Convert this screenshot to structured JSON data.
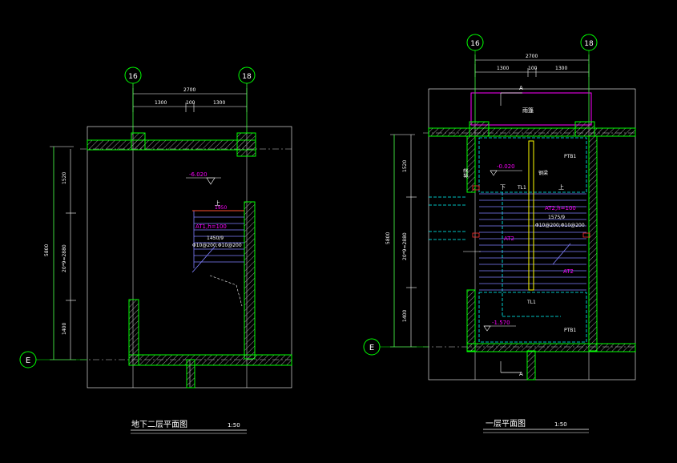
{
  "colors": {
    "background": "#000000",
    "wall": "#00ff00",
    "dimension": "#ffffff",
    "label": "#ff00ff",
    "hatch": "#808080",
    "stair": "#8080ff",
    "cyan": "#00ffff",
    "yellow": "#ffff00",
    "red": "#ff3030"
  },
  "left_plan": {
    "axis_left": "16",
    "axis_right": "18",
    "axis_bottom": "E",
    "dim_total_top": "2700",
    "dim_parts_top": [
      "1300",
      "100",
      "1300"
    ],
    "dim_total_side": "5800",
    "dim_side_parts": [
      "1520",
      "20*9=2880",
      "1400"
    ],
    "elevation": "-6.020",
    "up_label": "上",
    "stair_tag": "AT1,h=100",
    "stair_spec": "1450/9",
    "stair_rebar": "Φ10@200;Φ10@200",
    "stair_note": "1950",
    "title": "地下二层平面图",
    "scale": "1:50"
  },
  "right_plan": {
    "axis_left": "16",
    "axis_right": "18",
    "axis_bottom": "E",
    "dim_total_top": "2700",
    "dim_parts_top": [
      "1300",
      "100",
      "1300"
    ],
    "dim_total_side": "5800",
    "dim_side_parts": [
      "1520",
      "20*9=2880",
      "1400"
    ],
    "section_mark": "A",
    "canopy_label": "雨篷",
    "beam_tag_top": "PTB1",
    "beam_tag_bottom": "PTB1",
    "elev_top": "-0.020",
    "elev_bottom": "-1.570",
    "side_label": "钢梁",
    "vert_label": "梯梁",
    "down_label": "下",
    "up_label": "上",
    "tl_top": "TL1",
    "tl_bottom": "TL1",
    "stair_tag": "AT2,h=100",
    "stair_spec": "1575/9",
    "stair_rebar": "Φ10@200;Φ10@200",
    "at_mid": "AT2",
    "at_low": "AT2",
    "title": "一层平面图",
    "scale": "1:50"
  }
}
